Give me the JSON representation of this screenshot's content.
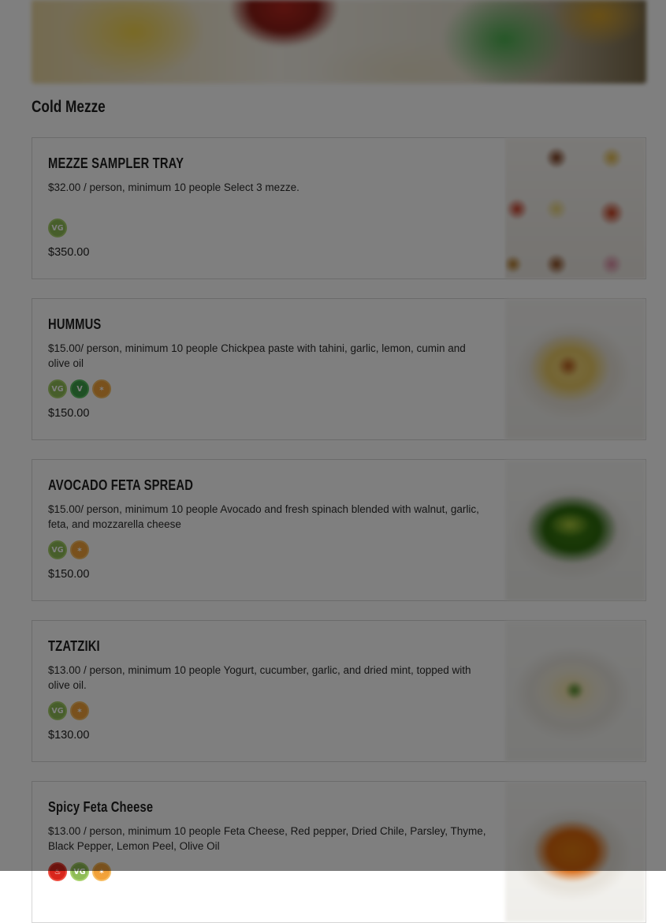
{
  "section": {
    "title": "Cold Mezze"
  },
  "items": [
    {
      "name": "MEZZE SAMPLER TRAY",
      "description": "$32.00 / person, minimum 10 people Select 3 mezze.",
      "badges": [
        {
          "label": "VG",
          "icon": "vegetarian-icon"
        }
      ],
      "price": "$350.00"
    },
    {
      "name": "HUMMUS",
      "description": "$15.00/ person, minimum 10 people Chickpea paste with tahini, garlic, lemon, cumin and olive oil",
      "badges": [
        {
          "label": "VG",
          "icon": "vegetarian-icon"
        },
        {
          "label": "V",
          "icon": "vegan-icon"
        },
        {
          "label": "✶",
          "icon": "gluten-free-icon"
        }
      ],
      "price": "$150.00"
    },
    {
      "name": "AVOCADO FETA SPREAD",
      "description": "$15.00/ person, minimum 10 people Avocado and fresh spinach blended with walnut, garlic, feta, and mozzarella cheese",
      "badges": [
        {
          "label": "VG",
          "icon": "vegetarian-icon"
        },
        {
          "label": "✶",
          "icon": "gluten-free-icon"
        }
      ],
      "price": "$150.00"
    },
    {
      "name": "TZATZIKI",
      "description": "$13.00 / person, minimum 10 people Yogurt, cucumber, garlic, and dried mint, topped with olive oil.",
      "badges": [
        {
          "label": "VG",
          "icon": "vegetarian-icon"
        },
        {
          "label": "✶",
          "icon": "gluten-free-icon"
        }
      ],
      "price": "$130.00"
    },
    {
      "name": "Spicy Feta Cheese",
      "description": "$13.00 / person, minimum 10 people Feta Cheese, Red pepper, Dried Chile, Parsley, Thyme, Black Pepper, Lemon Peel, Olive Oil",
      "badges": [
        {
          "label": "♨",
          "icon": "spicy-icon"
        },
        {
          "label": "VG",
          "icon": "vegetarian-icon"
        },
        {
          "label": "✶",
          "icon": "gluten-free-icon"
        }
      ],
      "price": ""
    }
  ]
}
